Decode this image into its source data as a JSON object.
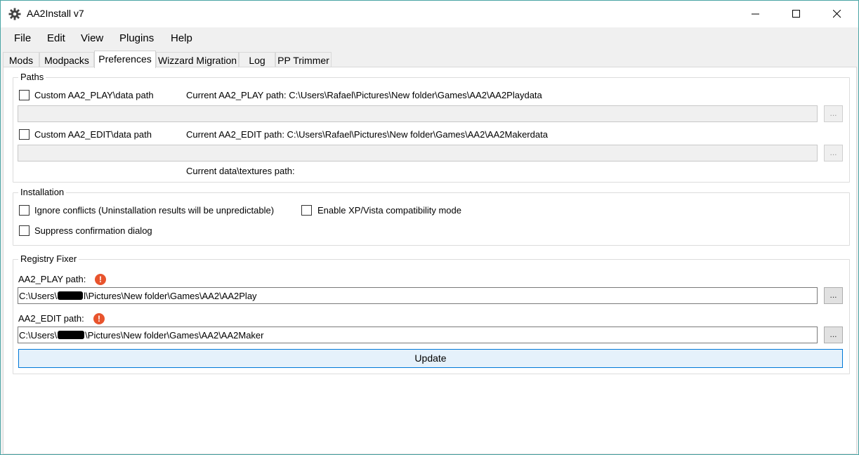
{
  "window": {
    "title": "AA2Install v7"
  },
  "menu": [
    "File",
    "Edit",
    "View",
    "Plugins",
    "Help"
  ],
  "tabs": [
    "Mods",
    "Modpacks",
    "Preferences",
    "Wizzard Migration",
    "Log",
    "PP Trimmer"
  ],
  "paths": {
    "group_title": "Paths",
    "custom_play_label": "Custom AA2_PLAY\\data path",
    "current_play": "Current AA2_PLAY path: C:\\Users\\Rafael\\Pictures\\New folder\\Games\\AA2\\AA2Playdata",
    "custom_edit_label": "Custom AA2_EDIT\\data path",
    "current_edit": "Current AA2_EDIT path: C:\\Users\\Rafael\\Pictures\\New folder\\Games\\AA2\\AA2Makerdata",
    "current_textures": "Current data\\textures path:",
    "browse_label": "..."
  },
  "installation": {
    "group_title": "Installation",
    "ignore_conflicts": "Ignore conflicts (Uninstallation results will be unpredictable)",
    "xp_vista": "Enable XP/Vista compatibility mode",
    "suppress_dialog": "Suppress confirmation dialog"
  },
  "registry": {
    "group_title": "Registry Fixer",
    "play_label": "AA2_PLAY path:",
    "play_value_prefix": "C:\\Users\\",
    "play_value_suffix": "l\\Pictures\\New folder\\Games\\AA2\\AA2Play",
    "edit_label": "AA2_EDIT path:",
    "edit_value_prefix": "C:\\Users\\",
    "edit_value_suffix": "\\Pictures\\New folder\\Games\\AA2\\AA2Maker",
    "browse_label": "...",
    "update_label": "Update"
  }
}
